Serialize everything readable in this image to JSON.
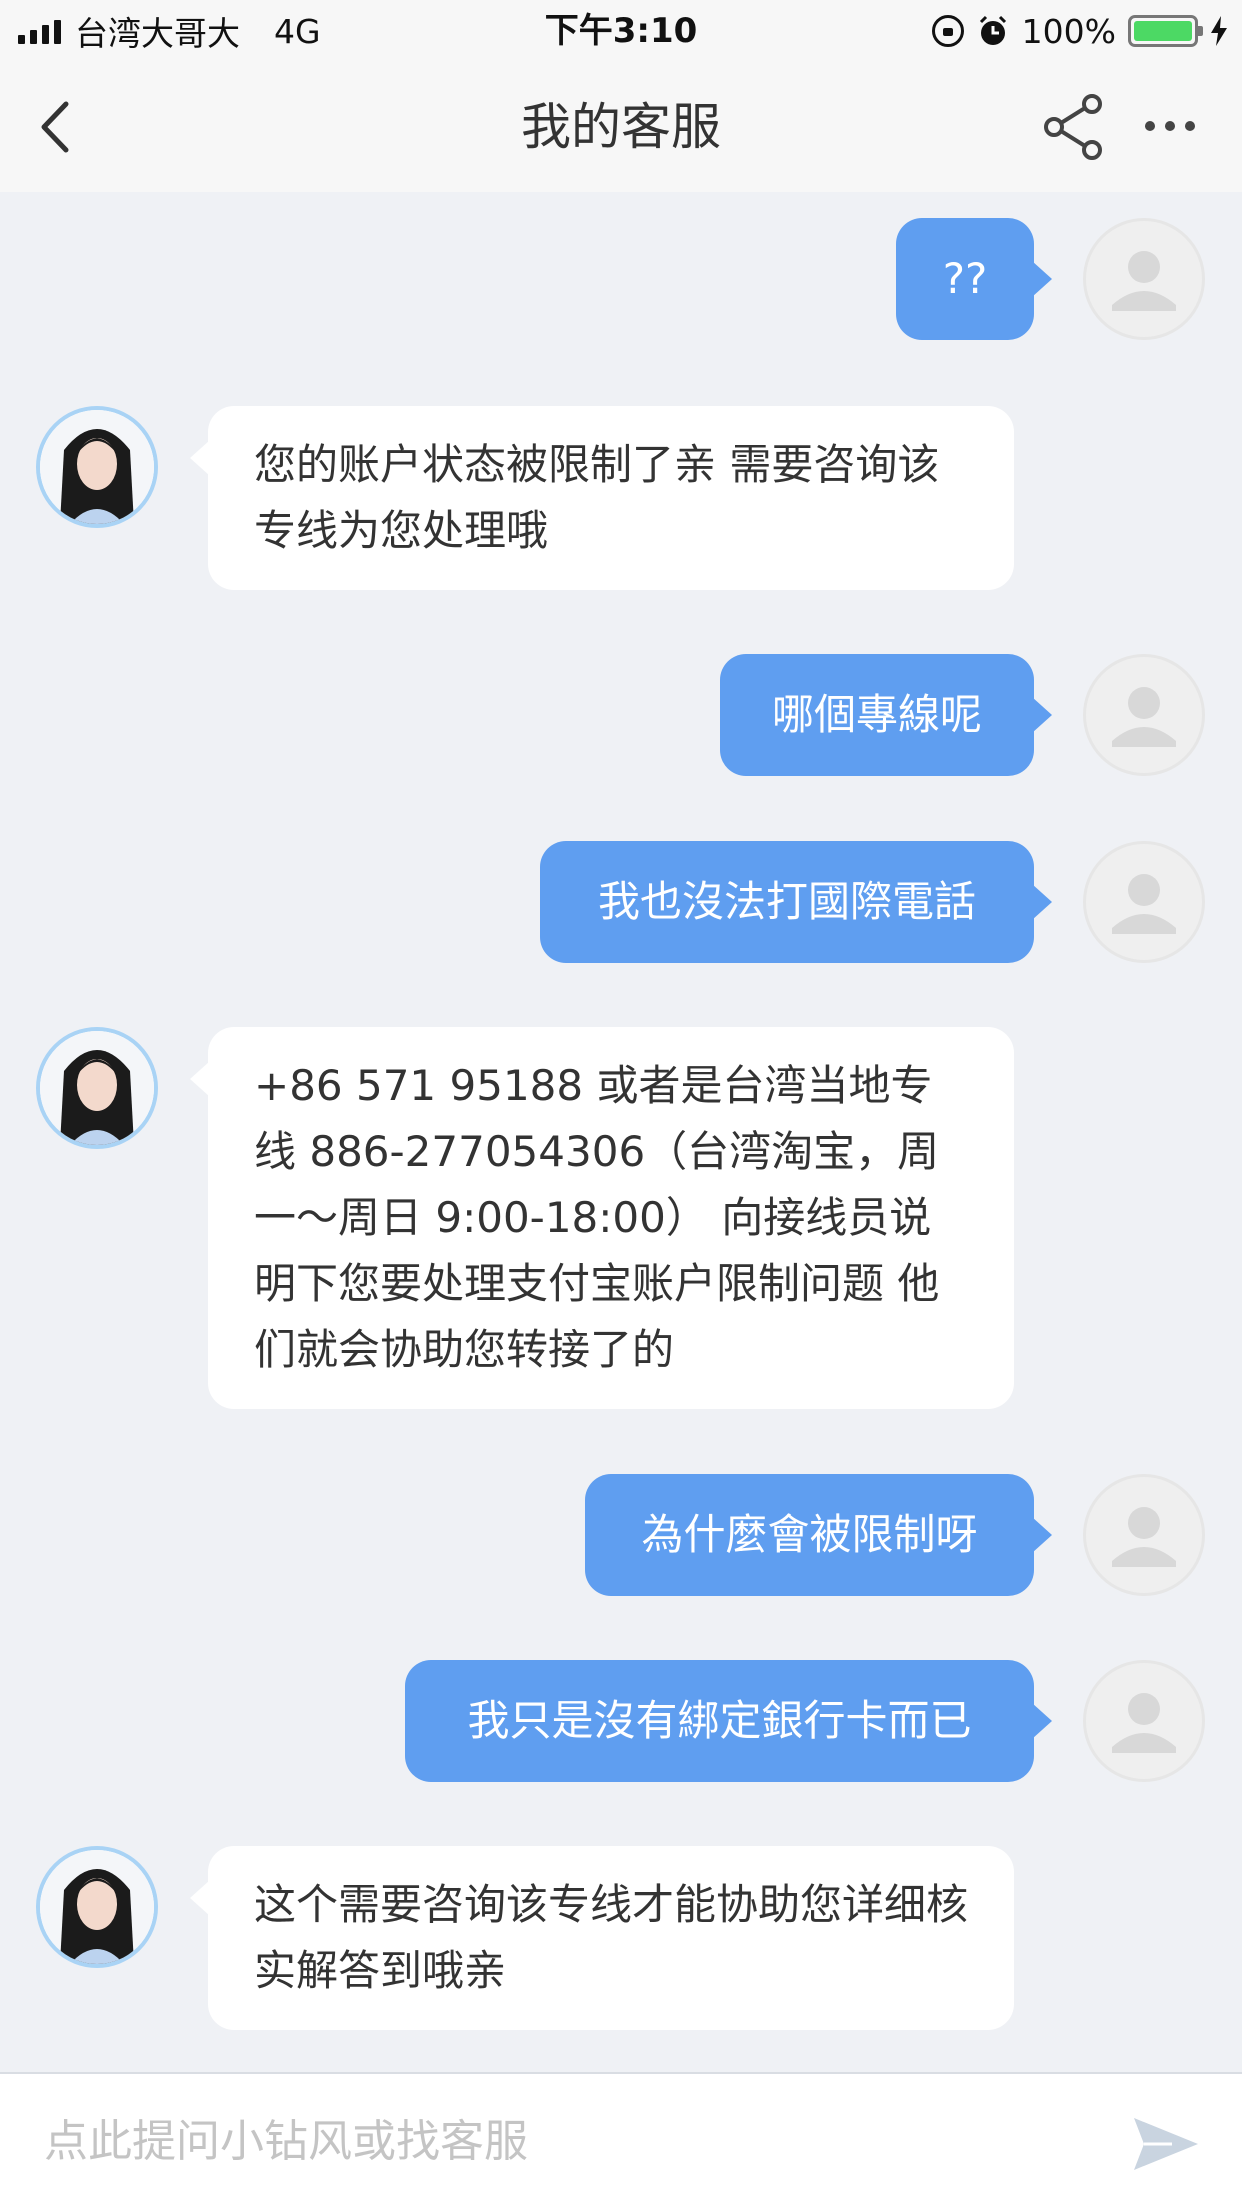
{
  "status_bar": {
    "carrier": "台湾大哥大",
    "network": "4G",
    "time": "下午3:10",
    "battery": "100%",
    "battery_level": 1.0,
    "icons": [
      "signal-icon",
      "rotation-lock-icon",
      "alarm-icon",
      "battery-icon",
      "charging-icon"
    ]
  },
  "nav": {
    "title": "我的客服",
    "icons": [
      "back-icon",
      "share-icon",
      "more-icon"
    ]
  },
  "messages": [
    {
      "side": "out",
      "text": "??"
    },
    {
      "side": "in",
      "text": "您的账户状态被限制了亲 需要咨询该专线为您处理哦"
    },
    {
      "side": "out",
      "text": "哪個專線呢"
    },
    {
      "side": "out",
      "text": "我也沒法打國際電話"
    },
    {
      "side": "in",
      "text": "+86 571 95188 或者是台湾当地专线 886-277054306（台湾淘宝，周一～周日 9:00-18:00） 向接线员说明下您要处理支付宝账户限制问题 他们就会协助您转接了的"
    },
    {
      "side": "out",
      "text": "為什麼會被限制呀"
    },
    {
      "side": "out",
      "text": "我只是沒有綁定銀行卡而已"
    },
    {
      "side": "in",
      "text": "这个需要咨询该专线才能协助您详细核实解答到哦亲"
    }
  ],
  "input": {
    "placeholder": "点此提问小钻风或找客服",
    "value": ""
  },
  "colors": {
    "outgoing_bubble": "#5f9ef0",
    "incoming_bubble": "#ffffff",
    "chat_background": "#eff1f5",
    "bar_background": "#f7f7f7"
  }
}
